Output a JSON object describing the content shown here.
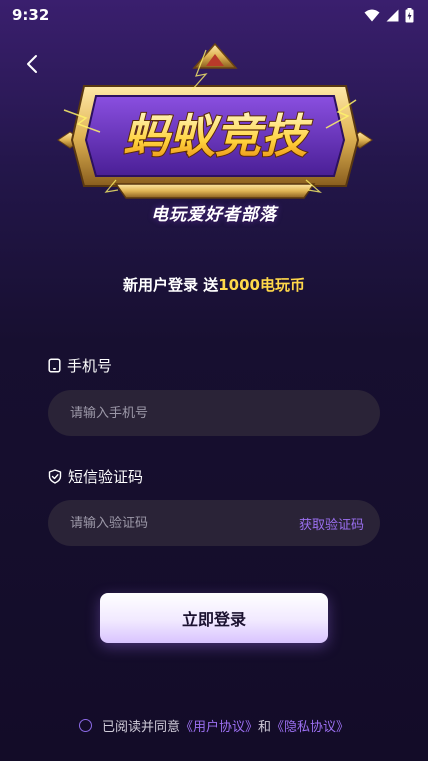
{
  "status": {
    "time": "9:32"
  },
  "logo": {
    "title": "蚂蚁竞技",
    "slogan": "电玩爱好者部落"
  },
  "promo": {
    "prefix": "新用户登录 送",
    "highlight": "1000电玩币"
  },
  "phone": {
    "label": "手机号",
    "placeholder": "请输入手机号"
  },
  "code": {
    "label": "短信验证码",
    "placeholder": "请输入验证码",
    "get_code": "获取验证码"
  },
  "login_button": "立即登录",
  "agreement": {
    "prefix": "已阅读并同意",
    "user_agreement": "《用户协议》",
    "and": "和",
    "privacy_policy": "《隐私协议》"
  },
  "colors": {
    "accent": "#9b6ff0",
    "highlight": "#ffd84a",
    "input_bg": "#2a2337"
  }
}
